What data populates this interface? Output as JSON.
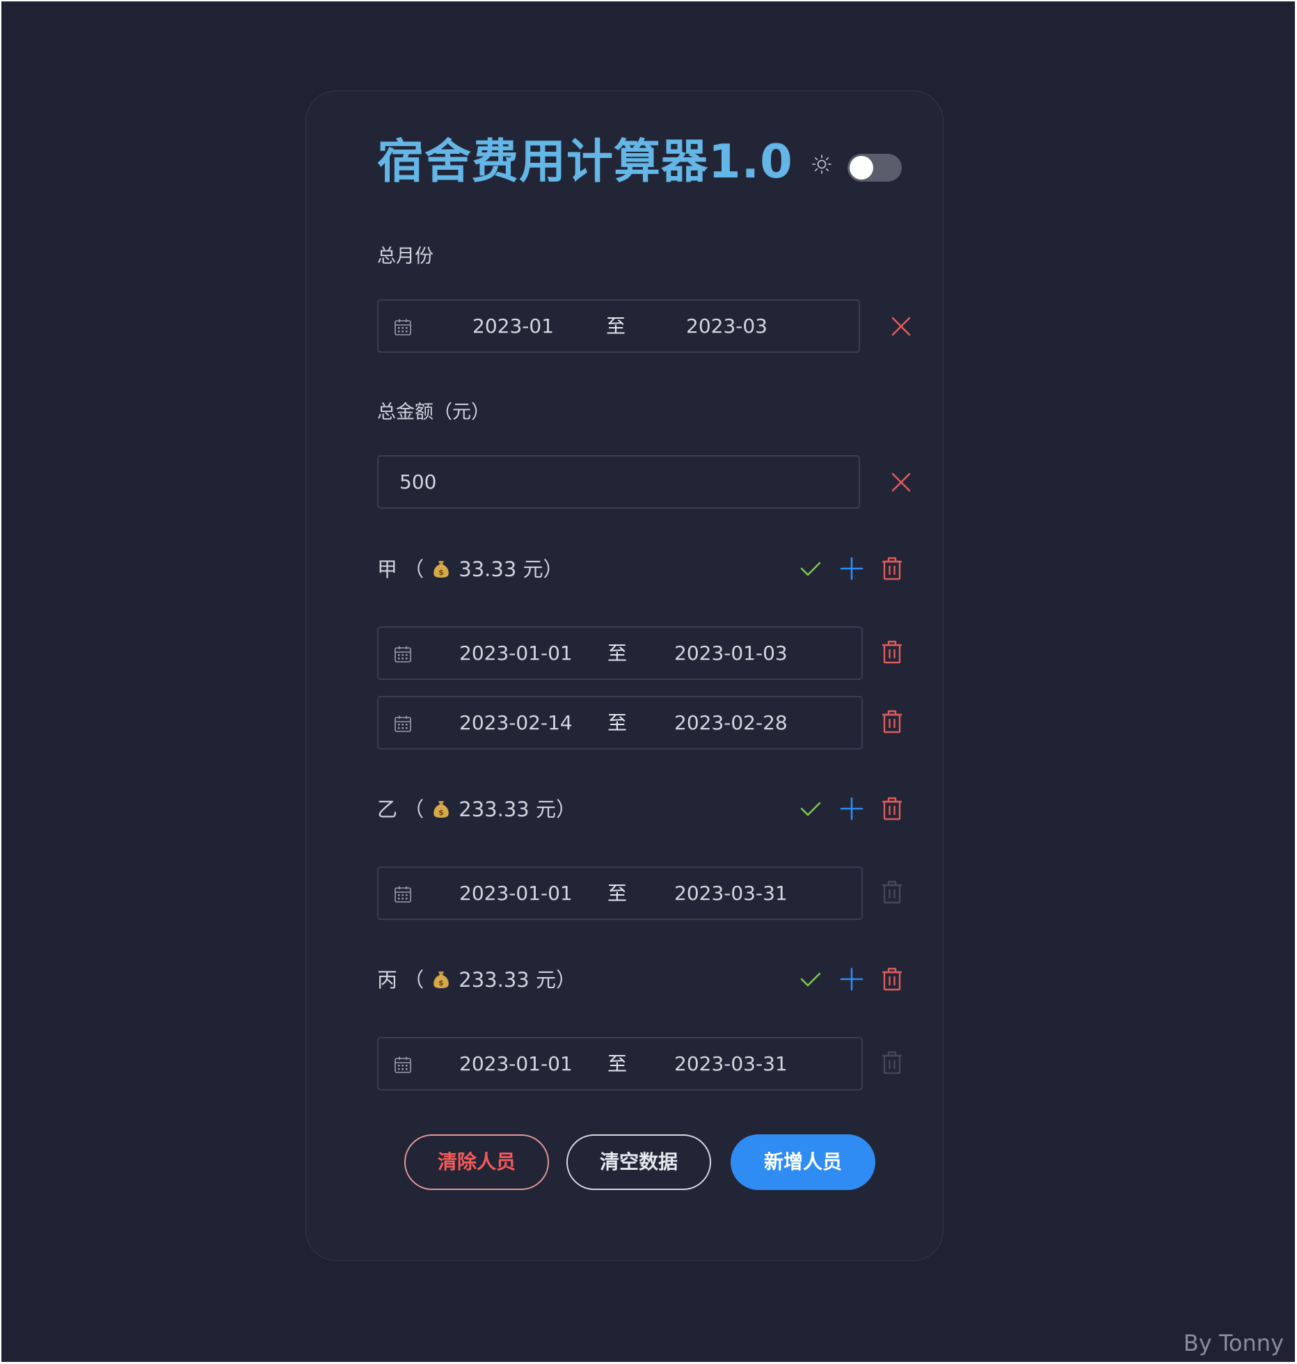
{
  "app": {
    "title": "宿舍费用计算器1.0",
    "theme_toggle_on": false
  },
  "month_range": {
    "label": "总月份",
    "start": "2023-01",
    "separator": "至",
    "end": "2023-03"
  },
  "total_amount": {
    "label": "总金额（元）",
    "value": "500"
  },
  "people": [
    {
      "name": "甲",
      "open_paren": "（",
      "amount": "33.33",
      "unit_close": "元）",
      "ranges": [
        {
          "start": "2023-01-01",
          "separator": "至",
          "end": "2023-01-03",
          "deletable": true
        },
        {
          "start": "2023-02-14",
          "separator": "至",
          "end": "2023-02-28",
          "deletable": true
        }
      ]
    },
    {
      "name": "乙",
      "open_paren": "（",
      "amount": "233.33",
      "unit_close": "元）",
      "ranges": [
        {
          "start": "2023-01-01",
          "separator": "至",
          "end": "2023-03-31",
          "deletable": false
        }
      ]
    },
    {
      "name": "丙",
      "open_paren": "（",
      "amount": "233.33",
      "unit_close": "元）",
      "ranges": [
        {
          "start": "2023-01-01",
          "separator": "至",
          "end": "2023-03-31",
          "deletable": false
        }
      ]
    }
  ],
  "actions": {
    "clear_people": "清除人员",
    "clear_data": "清空数据",
    "add_person": "新增人员"
  },
  "byline": "By Tonny",
  "icons": {
    "theme": "sun-icon",
    "date": "calendar-icon",
    "clear": "close-icon",
    "confirm": "check-icon",
    "add": "plus-icon",
    "delete": "trash-icon",
    "money": "money-bag-icon"
  },
  "colors": {
    "background": "#202233",
    "card": "#222536",
    "title": "#63b6e6",
    "danger": "#e15b5b",
    "success": "#7cc84d",
    "primary": "#2f8cf2",
    "disabled": "#454858"
  }
}
